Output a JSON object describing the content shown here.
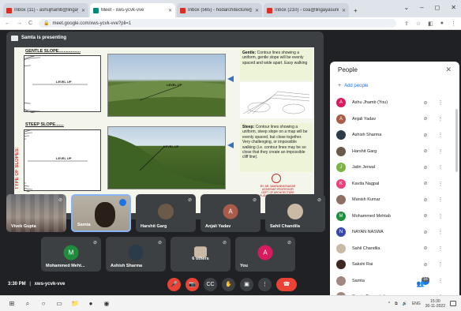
{
  "browser": {
    "tabs": [
      {
        "label": "Inbox (11) - ashujhamb@lingayas",
        "color": "#d93025",
        "active": false
      },
      {
        "label": "Meet - xws-ycvk-vve",
        "color": "#00897b",
        "active": true
      },
      {
        "label": "Inbox (565) - hodarchitecture@",
        "color": "#d93025",
        "active": false
      },
      {
        "label": "Inbox (210) - coa@lingayasuniv",
        "color": "#d93025",
        "active": false
      }
    ],
    "new_tab": "+",
    "win_controls": [
      "⌄",
      "–",
      "◻",
      "✕"
    ],
    "url": "meet.google.com/xws-ycvk-vve?pli=1",
    "nav": [
      "←",
      "→",
      "C"
    ],
    "addr_icons": [
      "⇪",
      "☆",
      "◧",
      "●",
      "⋮"
    ]
  },
  "presentation": {
    "banner": "Samta is presenting",
    "side_label": "TYPE OF SLOPES:",
    "gentle_title": "GENTLE SLOPE..................",
    "steep_title": "STEEP SLOPE.......",
    "level_up": "LEVEL UP",
    "gentle_desc_bold": "Gentle:",
    "gentle_desc": " Contour lines showing a uniform, gentle slope will be evenly spaced and wide apart. Easy walking",
    "steep_desc_bold": "Steep:",
    "steep_desc": " Contour lines showing a uniform, steep slope on a map will be evenly spaced, but close together. Very challenging, or impossible walking (i.e. contour lines may be so close that they create an impossible cliff line).",
    "credit": "BY: AR. SAMTA BHATNAGAR\nASSISTANT PROFESSOR\nDEPT. OF ARCHITECTURE\nSCHOOL OF PLANNING AND ARCHITECTURE, BHOPAL"
  },
  "tiles_row1": [
    {
      "name": "Vivek Gupta",
      "type": "photo"
    },
    {
      "name": "Samta",
      "type": "camera"
    },
    {
      "name": "Harshit Garg",
      "type": "photo-avatar",
      "avcolor": "#6b5a4a"
    },
    {
      "name": "Anjali Yadav",
      "type": "letter",
      "letter": "A",
      "avcolor": "#a95c4a"
    },
    {
      "name": "Sahil Chandila",
      "type": "photo-avatar",
      "avcolor": "#c9b9a5"
    }
  ],
  "tiles_row2": [
    {
      "name": "Mohammed Meht...",
      "type": "letter",
      "letter": "M",
      "avcolor": "#1e8e3e"
    },
    {
      "name": "Ashish Sharma",
      "type": "photo-avatar",
      "avcolor": "#2c3b48"
    },
    {
      "name": "6 others",
      "type": "group"
    },
    {
      "name": "You",
      "type": "letter",
      "letter": "A",
      "avcolor": "#d81b60"
    }
  ],
  "bottombar": {
    "time": "3:30 PM",
    "sep": "|",
    "code": "xws-ycvk-vve",
    "controls": [
      "🎤",
      "📷",
      "CC",
      "✋",
      "▣",
      "⋮",
      "☎"
    ],
    "right": [
      "ⓘ",
      "👥",
      "☷",
      "⬡"
    ],
    "people_badge": "16"
  },
  "people": {
    "title": "People",
    "close": "✕",
    "add_icon": "+",
    "add_label": "Add people",
    "mute_icon": "⊘",
    "more_icon": "⋮",
    "list": [
      {
        "name": "Ashu Jhamb (You)",
        "letter": "A",
        "color": "#d81b60"
      },
      {
        "name": "Anjali Yadav",
        "letter": "A",
        "color": "#a95c4a"
      },
      {
        "name": "Ashish Sharma",
        "letter": "",
        "color": "#2c3b48"
      },
      {
        "name": "Harshit Garg",
        "letter": "",
        "color": "#6b5a4a"
      },
      {
        "name": "Jatin Jerwal",
        "letter": "J",
        "color": "#7cb342"
      },
      {
        "name": "Kavita Nagpal",
        "letter": "K",
        "color": "#ec407a"
      },
      {
        "name": "Manish Kumar",
        "letter": "",
        "color": "#8d6e63"
      },
      {
        "name": "Mohammed Mehtab",
        "letter": "M",
        "color": "#1e8e3e"
      },
      {
        "name": "NAYAN NASWA",
        "letter": "N",
        "color": "#3949ab"
      },
      {
        "name": "Sahil Chandila",
        "letter": "",
        "color": "#c9b9a5"
      },
      {
        "name": "Sakshi Rai",
        "letter": "",
        "color": "#3e2723"
      },
      {
        "name": "Samta",
        "letter": "",
        "color": "#a1887f"
      },
      {
        "name": "Samta Presentation",
        "letter": "",
        "color": "#a1887f"
      }
    ]
  },
  "taskbar": {
    "icons": [
      "⊞",
      "⌕",
      "○",
      "▭",
      "📁",
      "●",
      "◉"
    ],
    "tray": [
      "^",
      "⧉",
      "🔊",
      "ENG"
    ],
    "time": "15:30",
    "date": "30-11-2022"
  },
  "colors": {
    "meet_bg": "#202124",
    "tile_bg": "#3c4043",
    "accent": "#1a73e8",
    "danger": "#ea4335"
  }
}
